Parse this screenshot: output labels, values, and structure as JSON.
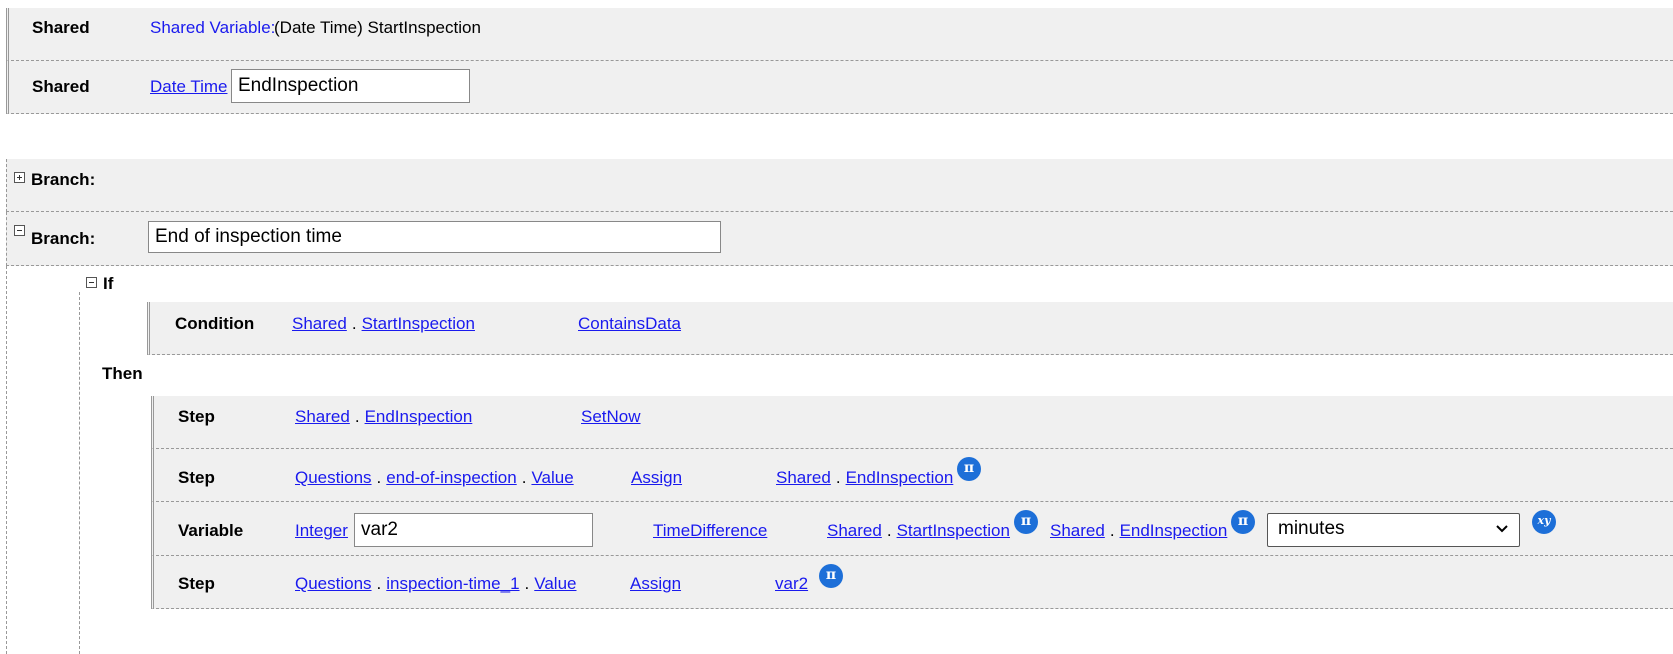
{
  "shared_section": {
    "row1": {
      "label": "Shared",
      "var_prefix": "Shared Variable:",
      "var_desc": "(Date Time) StartInspection"
    },
    "row2": {
      "label": "Shared",
      "type_link": "Date Time",
      "name_value": "EndInspection"
    }
  },
  "branch1": {
    "label": "Branch:"
  },
  "branch2": {
    "label": "Branch:",
    "name_value": "End of inspection time",
    "if_label": "If",
    "condition": {
      "label": "Condition",
      "obj": "Shared",
      "prop": "StartInspection",
      "op": "ContainsData"
    },
    "then_label": "Then",
    "step1": {
      "label": "Step",
      "obj": "Shared",
      "prop": "EndInspection",
      "action": "SetNow"
    },
    "step2": {
      "label": "Step",
      "obj": "Questions",
      "prop": "end-of-inspection",
      "sub": "Value",
      "action": "Assign",
      "src_obj": "Shared",
      "src_prop": "EndInspection"
    },
    "variable": {
      "label": "Variable",
      "type_link": "Integer",
      "name_value": "var2",
      "func": "TimeDifference",
      "arg1_obj": "Shared",
      "arg1_prop": "StartInspection",
      "arg2_obj": "Shared",
      "arg2_prop": "EndInspection",
      "unit_selected": "minutes"
    },
    "step3": {
      "label": "Step",
      "obj": "Questions",
      "prop": "inspection-time_1",
      "sub": "Value",
      "action": "Assign",
      "src": "var2"
    }
  },
  "icons": {
    "pi_glyph": "π",
    "xy_glyph": "xy",
    "chevron_glyph": "⌄"
  },
  "colors": {
    "link": "#1a1aee",
    "badge": "#1d6fd8",
    "row_bg": "#f0f0f0"
  }
}
